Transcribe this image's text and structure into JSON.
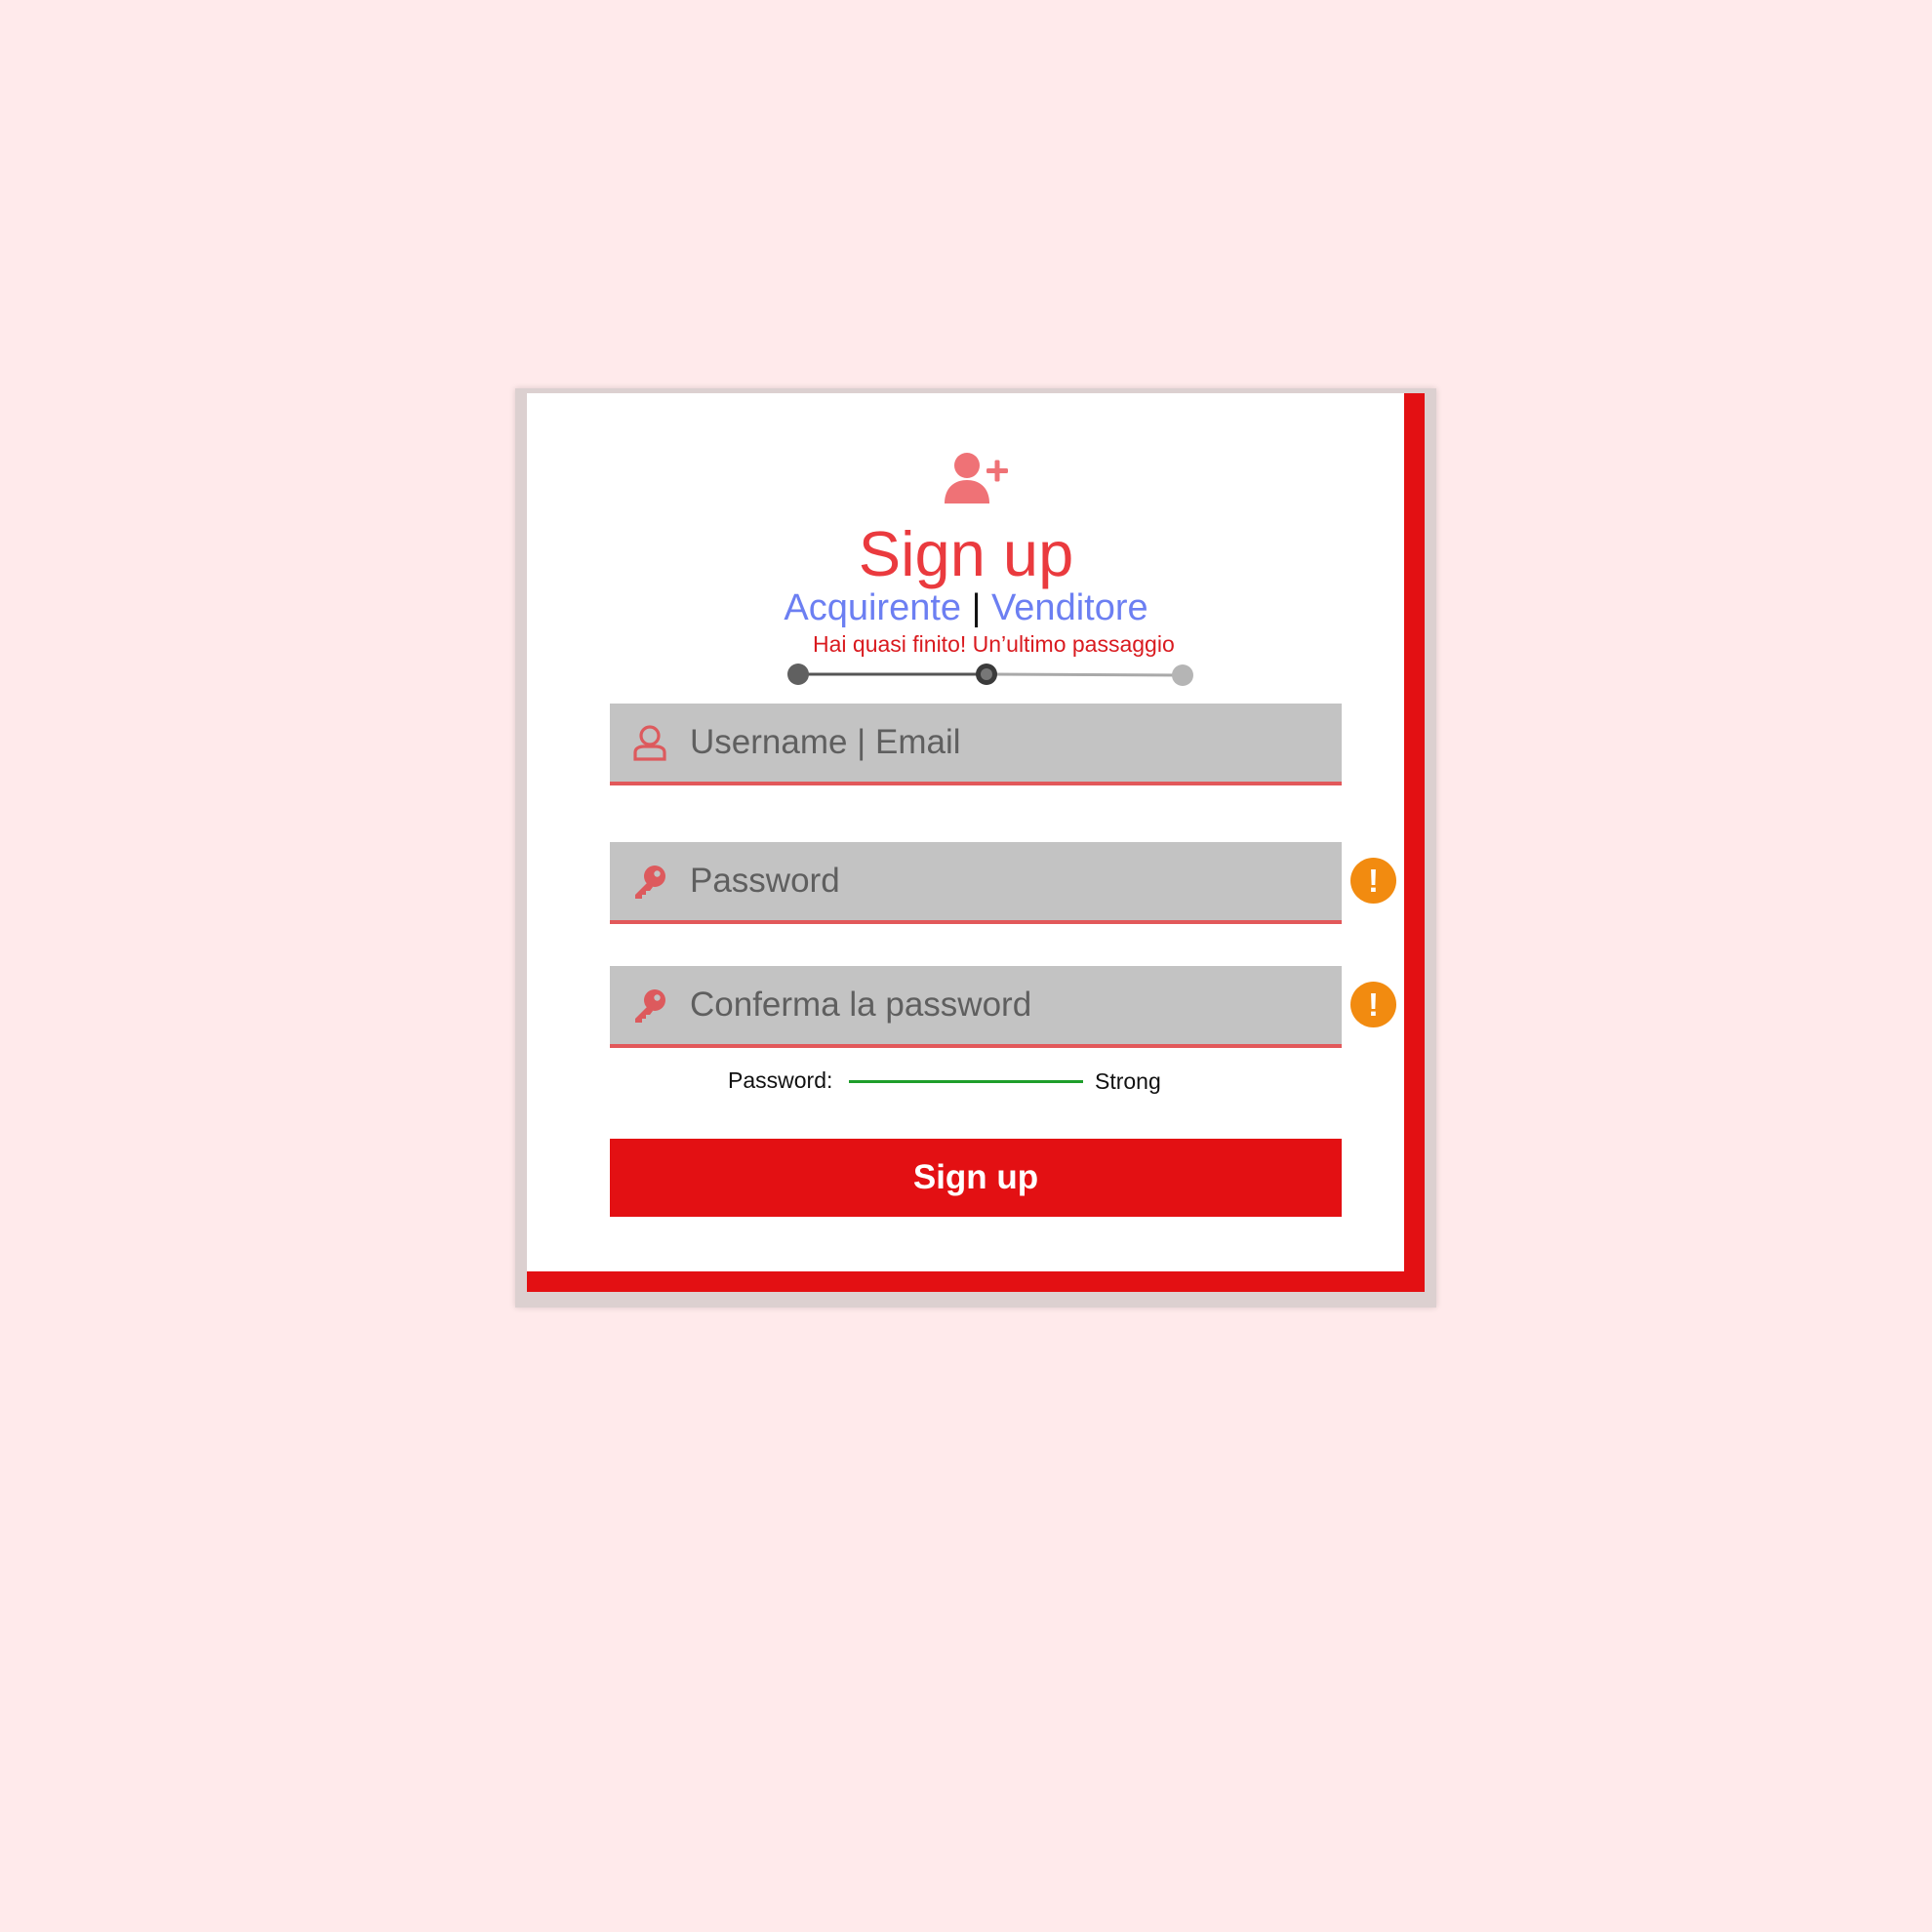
{
  "header": {
    "icon": "user-plus-icon",
    "title": "Sign up",
    "role_buyer": "Acquirente",
    "role_separator": "|",
    "role_seller": "Venditore",
    "subtitle": "Hai quasi finito! Un’ultimo passaggio"
  },
  "stepper": {
    "steps_total": 3,
    "current_step": 2
  },
  "form": {
    "username": {
      "placeholder": "Username | Email",
      "value": "",
      "icon": "user-icon"
    },
    "password": {
      "placeholder": "Password",
      "value": "",
      "icon": "key-icon",
      "warning_icon": "exclamation-icon",
      "warning_symbol": "!"
    },
    "confirm_password": {
      "placeholder": "Conferma la password",
      "value": "",
      "icon": "key-icon",
      "warning_icon": "exclamation-icon",
      "warning_symbol": "!"
    },
    "strength": {
      "label": "Password:",
      "value": "Strong",
      "level": 1.0
    },
    "submit_label": "Sign up"
  },
  "colors": {
    "page_background": "#ffeaeb",
    "accent_red": "#e31013",
    "title_red": "#ea3a3e",
    "link_blue": "#6c7ff2",
    "field_gray": "#c3c3c3",
    "warning_orange": "#f28b10",
    "strength_green": "#1e9e2b"
  }
}
